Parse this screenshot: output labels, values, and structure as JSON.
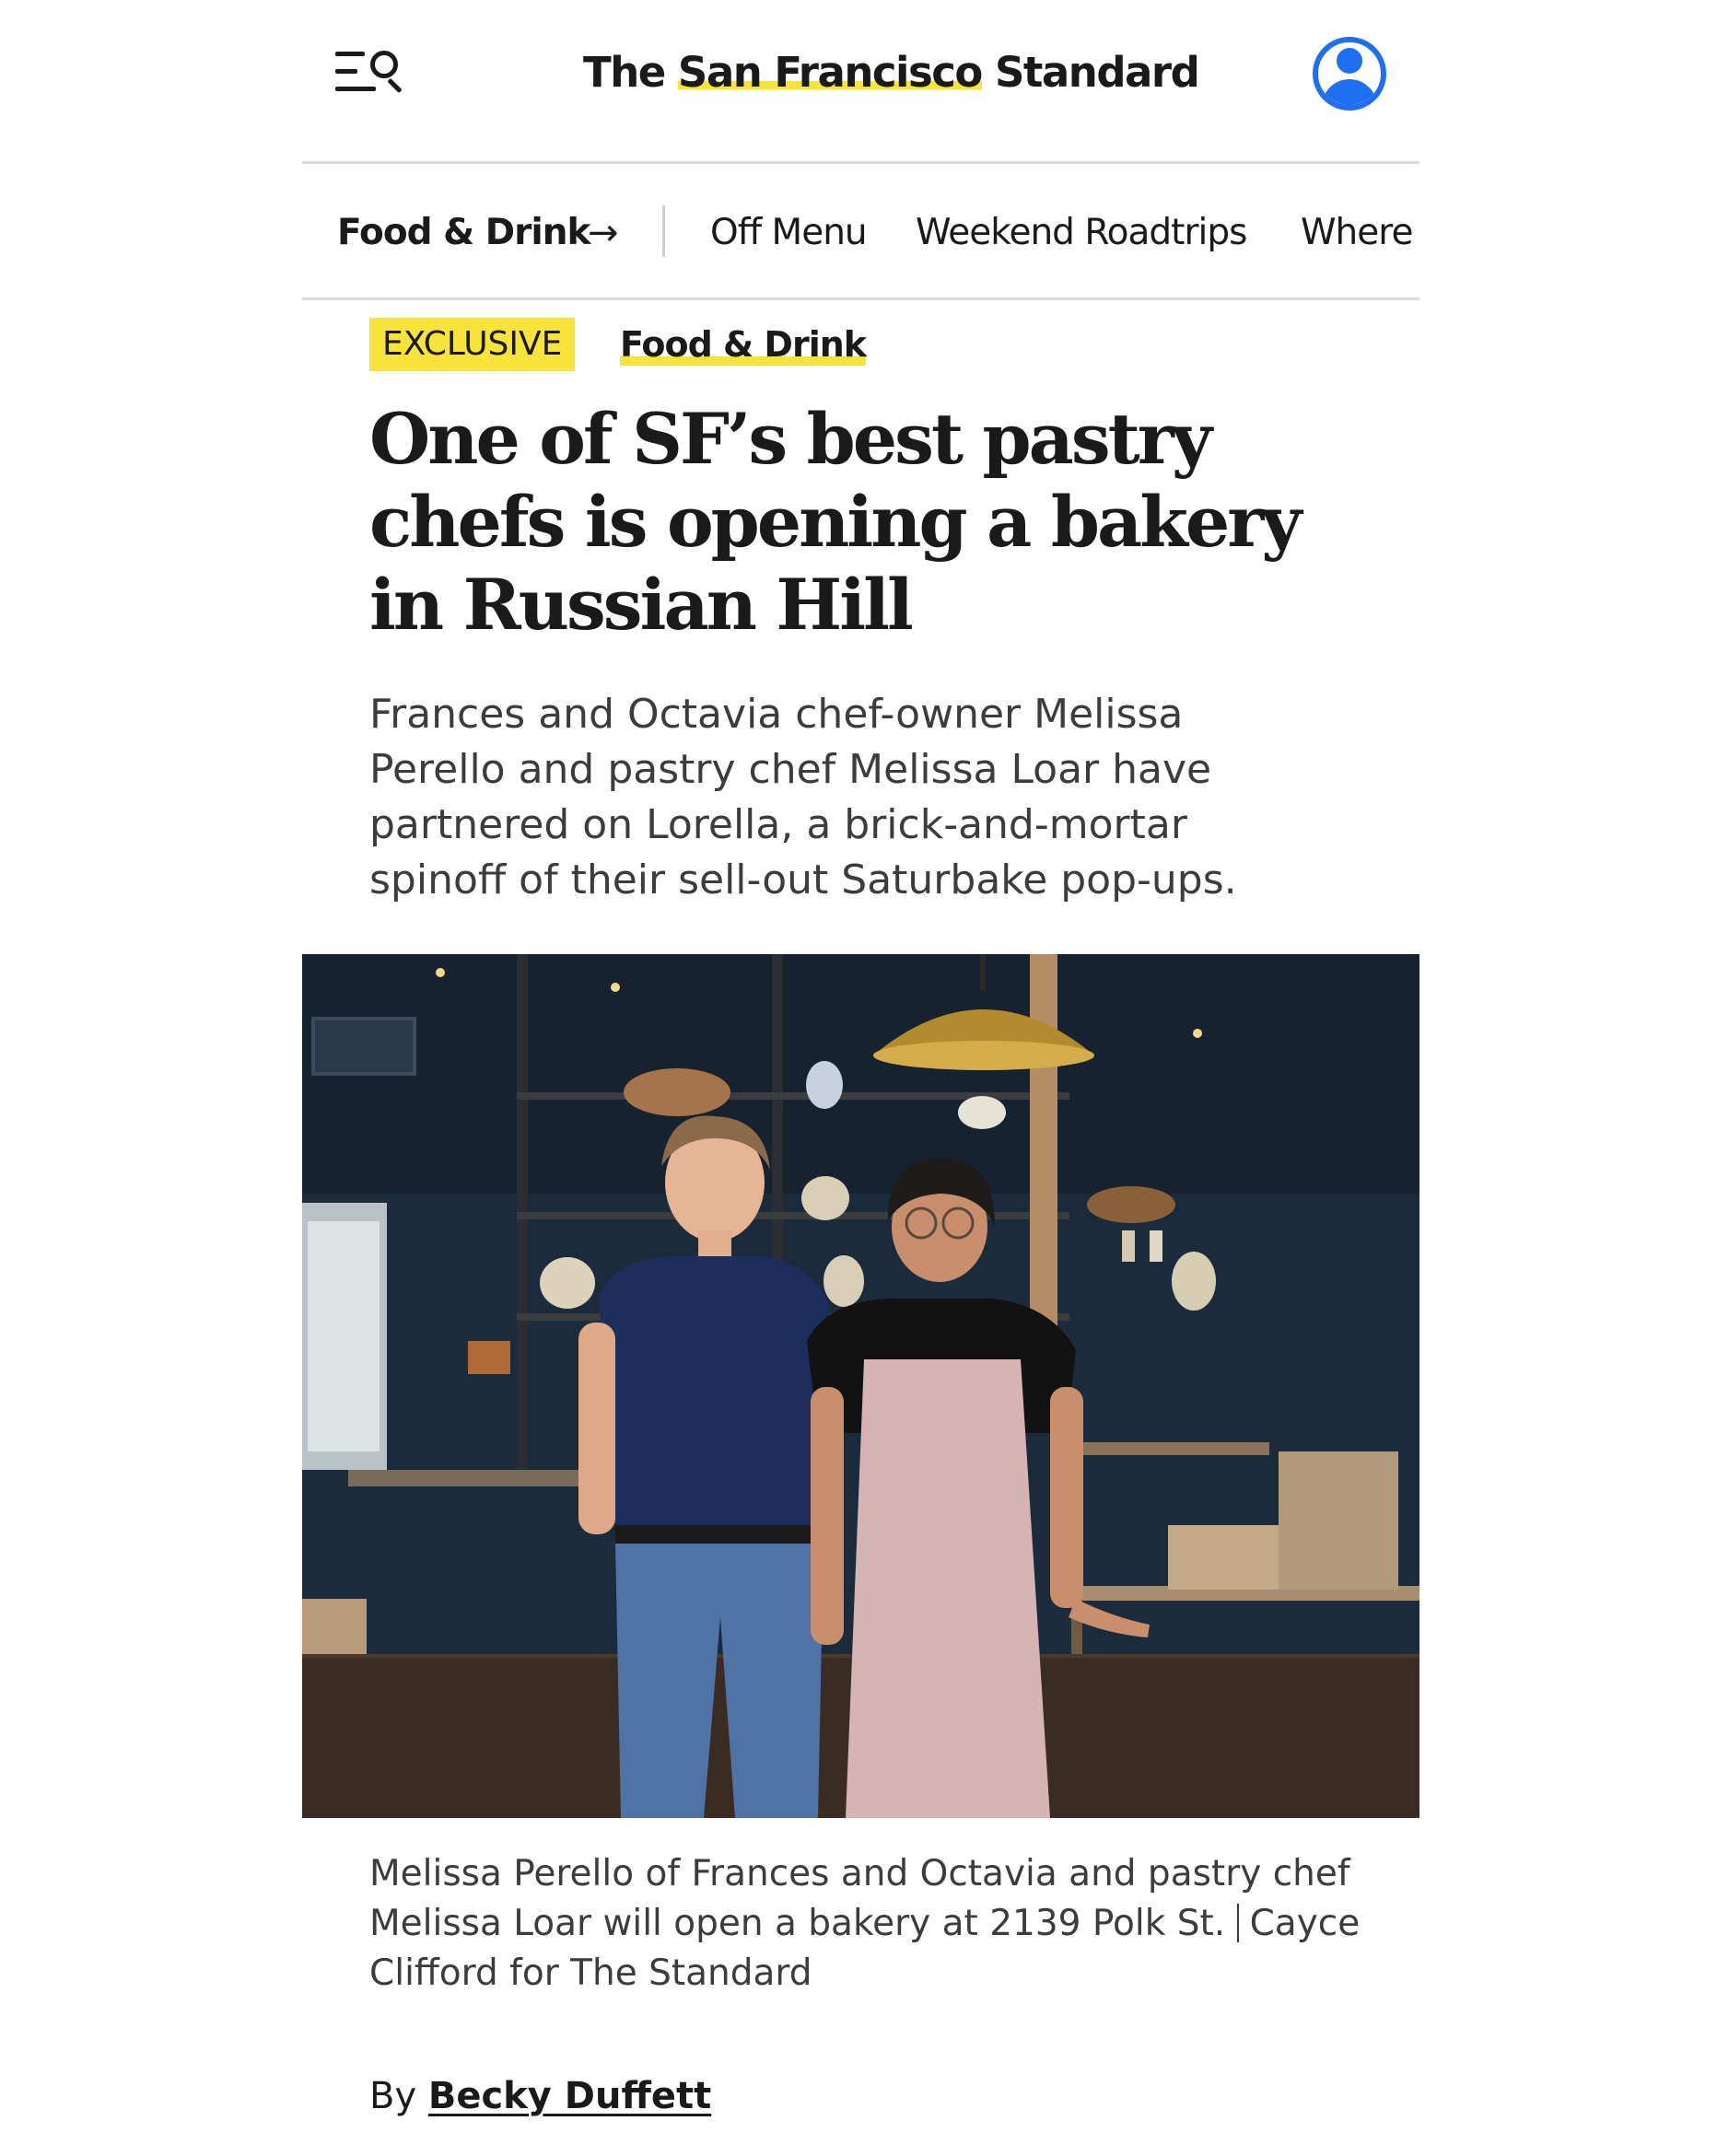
{
  "header": {
    "logo_prefix": "The ",
    "logo_highlight": "San Francisco",
    "logo_suffix": " Standard",
    "menu_icon": "menu-search-icon",
    "account_icon": "account-icon"
  },
  "section_nav": {
    "current": "Food & Drink",
    "arrow": "→",
    "items": [
      "Off Menu",
      "Weekend Roadtrips",
      "Where"
    ]
  },
  "article": {
    "badge": "EXCLUSIVE",
    "category": "Food & Drink",
    "headline": "One of SF’s best pastry chefs is opening a bakery in Russian Hill",
    "dek": "Frances and Octavia chef-owner Melissa Perello and pastry chef Melissa Loar have partnered on Lorella, a brick-and-mortar spinoff of their sell-out Saturbake pop-ups.",
    "caption": "Melissa Perello of Frances and Octavia and pastry chef Melissa Loar will open a bakery at 2139 Polk St.",
    "credit": "Cayce Clifford for The Standard",
    "byline_prefix": "By ",
    "author": "Becky Duffett"
  },
  "colors": {
    "accent_yellow": "#f7e33a",
    "account_blue": "#1f6ff0",
    "text": "#1a1a1a",
    "divider": "#d9d9d9"
  }
}
